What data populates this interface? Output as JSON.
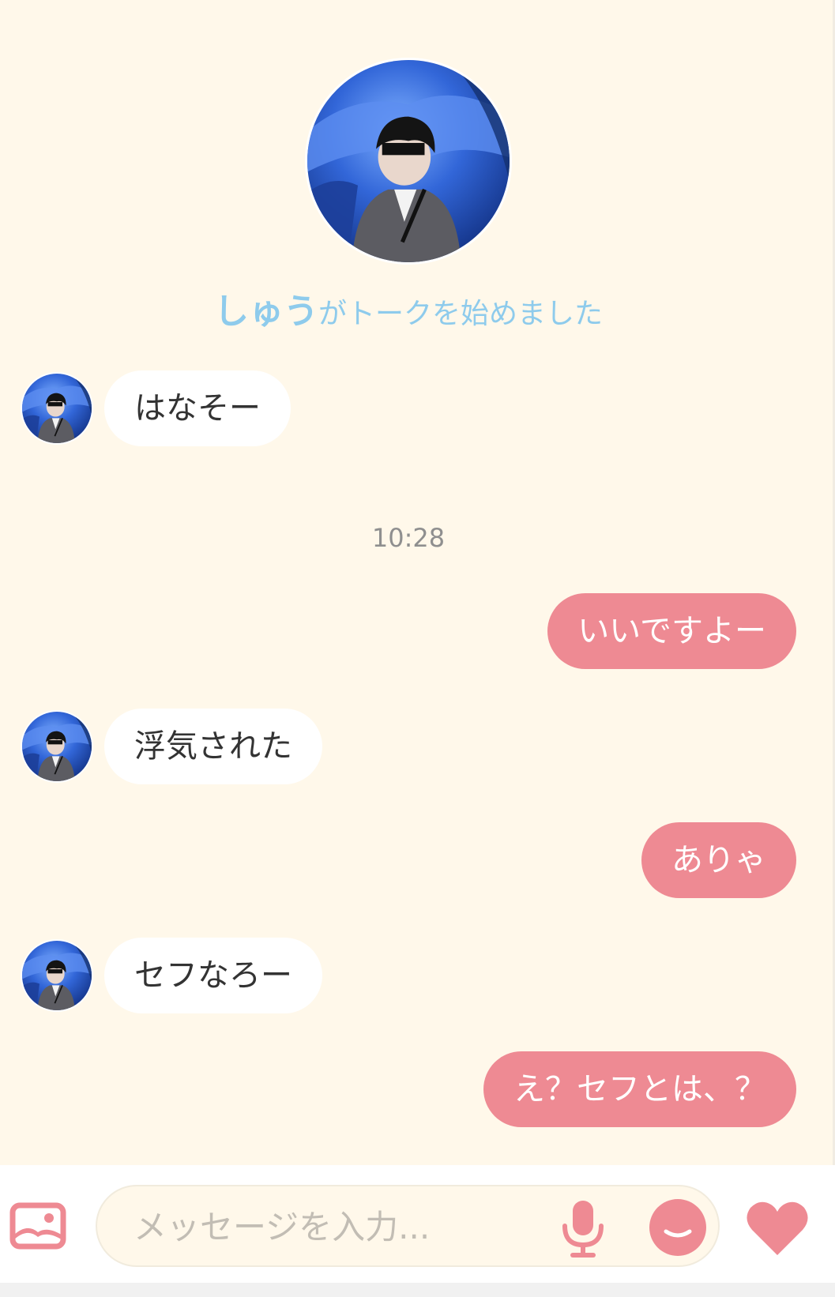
{
  "chat": {
    "started_name": "しゅう",
    "started_suffix": "がトークを始めました",
    "time_separator": "10:28",
    "messages": [
      {
        "side": "in",
        "text": "はなそー"
      },
      {
        "side": "out",
        "text": "いいですよー"
      },
      {
        "side": "in",
        "text": "浮気された"
      },
      {
        "side": "out",
        "text": "ありゃ"
      },
      {
        "side": "in",
        "text": "セフなろー"
      },
      {
        "side": "out",
        "text": "え？セフとは、？"
      }
    ]
  },
  "input_bar": {
    "placeholder": "メッセージを入力...",
    "icons": {
      "photo": "photo-icon",
      "mic": "microphone-icon",
      "emoji": "smile-icon",
      "like": "heart-icon"
    }
  },
  "colors": {
    "background": "#fff8ea",
    "outgoing_bubble": "#ee8a93",
    "incoming_bubble": "#ffffff",
    "accent_blue": "#8ecbec",
    "icon_pink": "#ee8a93"
  }
}
